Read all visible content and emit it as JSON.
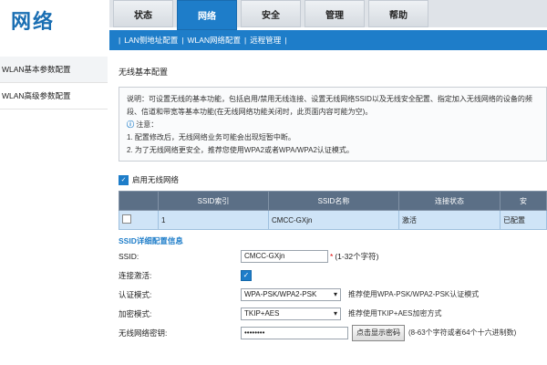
{
  "header": {
    "logo": "网络",
    "tabs": [
      {
        "label": "状态"
      },
      {
        "label": "网络",
        "active": true
      },
      {
        "label": "安全"
      },
      {
        "label": "管理"
      },
      {
        "label": "帮助"
      }
    ]
  },
  "subnav": {
    "items": [
      "LAN侧地址配置",
      "WLAN网络配置",
      "远程管理"
    ]
  },
  "sidebar": {
    "items": [
      {
        "label": "WLAN基本参数配置",
        "active": true
      },
      {
        "label": "WLAN高级参数配置"
      }
    ]
  },
  "main": {
    "section_title": "无线基本配置",
    "description": "说明：可设置无线的基本功能，包括启用/禁用无线连接、设置无线网络SSID以及无线安全配置、指定加入无线网络的设备的频段、信道和带宽等基本功能(在无线网络功能关闭时，此页面内容可能为空)。",
    "note_label": "注意：",
    "note_1": "1. 配置修改后，无线网络业务可能会出现短暂中断。",
    "note_2": "2. 为了无线网络更安全，推荐您使用WPA2或者WPA/WPA2认证模式。",
    "enable_label": "启用无线网络",
    "table": {
      "headers": [
        "",
        "SSID索引",
        "SSID名称",
        "连接状态",
        "安"
      ],
      "rows": [
        {
          "index": "1",
          "name": "CMCC-GXjn",
          "status": "激活",
          "security": "已配置"
        }
      ]
    },
    "detail_title": "SSID详细配置信息",
    "form": {
      "ssid_label": "SSID:",
      "ssid_value": "CMCC-GXjn",
      "ssid_hint": "(1-32个字符)",
      "enable_label": "连接激活:",
      "auth_label": "认证模式:",
      "auth_value": "WPA-PSK/WPA2-PSK",
      "auth_hint": "推荐使用WPA-PSK/WPA2-PSK认证模式",
      "encrypt_label": "加密模式:",
      "encrypt_value": "TKIP+AES",
      "encrypt_hint": "推荐使用TKIP+AES加密方式",
      "password_label": "无线网络密钥:",
      "password_value": "••••••••",
      "show_password_button": "点击显示密码",
      "password_hint": "(8-63个字符或者64个十六进制数)"
    }
  }
}
